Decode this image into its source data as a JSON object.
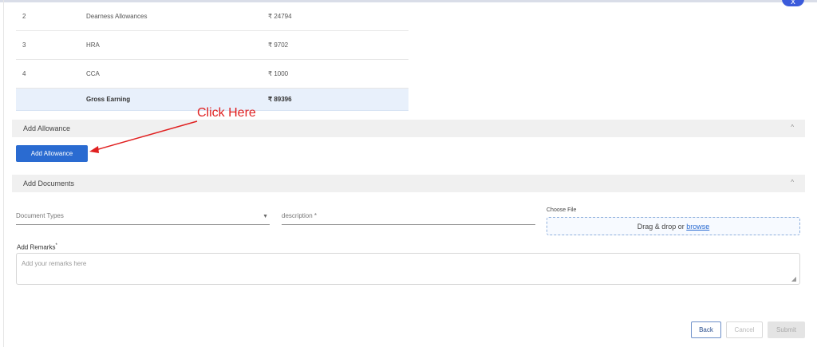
{
  "close_label": "x",
  "earnings_table": {
    "rows": [
      {
        "index": "2",
        "name": "Dearness Allowances",
        "amount": "₹ 24794"
      },
      {
        "index": "3",
        "name": "HRA",
        "amount": "₹ 9702"
      },
      {
        "index": "4",
        "name": "CCA",
        "amount": "₹ 1000"
      }
    ],
    "gross": {
      "label": "Gross Earning",
      "amount": "₹ 89396"
    }
  },
  "allowance_section": {
    "title": "Add Allowance",
    "chevron": "^",
    "button_label": "Add Allowance"
  },
  "annotation": {
    "text": "Click Here",
    "color": "#e02020"
  },
  "documents_section": {
    "title": "Add Documents",
    "chevron": "^",
    "document_types_placeholder": "Document Types",
    "description_placeholder": "description *",
    "choose_file_label": "Choose File",
    "dropzone_text": "Drag & drop or",
    "dropzone_link": "browse"
  },
  "remarks": {
    "label": "Add Remarks",
    "required_mark": "*",
    "placeholder": "Add your remarks here"
  },
  "footer": {
    "back_label": "Back",
    "cancel_label": "Cancel",
    "submit_label": "Submit"
  },
  "colors": {
    "primary": "#2a6bd1",
    "gross_row_bg": "#e8f0fb",
    "section_bg": "#f0f0f0"
  }
}
